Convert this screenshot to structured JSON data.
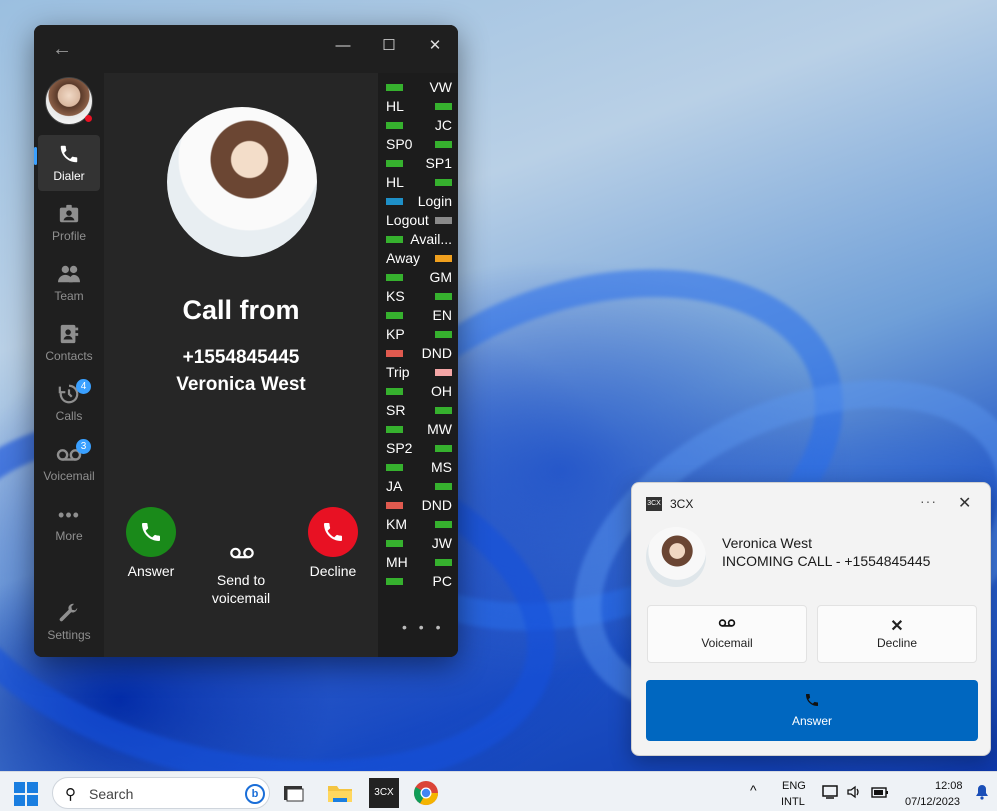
{
  "window": {
    "back_label": "←",
    "minimize_label": "—",
    "maximize_label": "☐",
    "close_label": "✕"
  },
  "nav": {
    "items": [
      {
        "label": "Dialer",
        "icon": "phone-icon",
        "active": true
      },
      {
        "label": "Profile",
        "icon": "id-badge-icon"
      },
      {
        "label": "Team",
        "icon": "team-icon"
      },
      {
        "label": "Contacts",
        "icon": "contacts-icon"
      },
      {
        "label": "Calls",
        "icon": "history-icon",
        "badge": "4"
      },
      {
        "label": "Voicemail",
        "icon": "voicemail-icon",
        "badge": "3"
      },
      {
        "label": "More",
        "icon": "more-icon"
      },
      {
        "label": "Settings",
        "icon": "wrench-icon"
      }
    ]
  },
  "call": {
    "heading": "Call from",
    "number": "+1554845445",
    "name": "Veronica West",
    "answer_label": "Answer",
    "voicemail_label_1": "Send to",
    "voicemail_label_2": "voicemail",
    "decline_label": "Decline",
    "answer_color": "#1a8a1a",
    "decline_color": "#e81123"
  },
  "presence": [
    {
      "label": "VW",
      "side": "right",
      "color": "#36b12e"
    },
    {
      "label": "HL",
      "side": "left",
      "color": "#36b12e"
    },
    {
      "label": "JC",
      "side": "right",
      "color": "#36b12e"
    },
    {
      "label": "SP0",
      "side": "left",
      "color": "#36b12e"
    },
    {
      "label": "SP1",
      "side": "right",
      "color": "#36b12e"
    },
    {
      "label": "HL",
      "side": "left",
      "color": "#36b12e"
    },
    {
      "label": "Login",
      "side": "right",
      "color": "#1e90c8"
    },
    {
      "label": "Logout",
      "side": "left",
      "color": "#8a8a8a"
    },
    {
      "label": "Avail...",
      "side": "right",
      "color": "#36b12e"
    },
    {
      "label": "Away",
      "side": "left",
      "color": "#f0a01e"
    },
    {
      "label": "GM",
      "side": "right",
      "color": "#36b12e"
    },
    {
      "label": "KS",
      "side": "left",
      "color": "#36b12e"
    },
    {
      "label": "EN",
      "side": "right",
      "color": "#36b12e"
    },
    {
      "label": "KP",
      "side": "left",
      "color": "#36b12e"
    },
    {
      "label": "DND",
      "side": "right",
      "color": "#e05a4f"
    },
    {
      "label": "Trip",
      "side": "left",
      "color": "#f4a6a6"
    },
    {
      "label": "OH",
      "side": "right",
      "color": "#36b12e"
    },
    {
      "label": "SR",
      "side": "left",
      "color": "#36b12e"
    },
    {
      "label": "MW",
      "side": "right",
      "color": "#36b12e"
    },
    {
      "label": "SP2",
      "side": "left",
      "color": "#36b12e"
    },
    {
      "label": "MS",
      "side": "right",
      "color": "#36b12e"
    },
    {
      "label": "JA",
      "side": "left",
      "color": "#36b12e"
    },
    {
      "label": "DND",
      "side": "right",
      "color": "#e05a4f"
    },
    {
      "label": "KM",
      "side": "left",
      "color": "#36b12e"
    },
    {
      "label": "JW",
      "side": "right",
      "color": "#36b12e"
    },
    {
      "label": "MH",
      "side": "left",
      "color": "#36b12e"
    },
    {
      "label": "PC",
      "side": "right",
      "color": "#36b12e"
    }
  ],
  "presence_more": "• • •",
  "toast": {
    "app_name": "3CX",
    "logo_text": "3CX",
    "more_label": "···",
    "close_label": "✕",
    "name": "Veronica West",
    "message": "INCOMING CALL - +1554845445",
    "voicemail_label": "Voicemail",
    "decline_label": "Decline",
    "answer_label": "Answer",
    "answer_color": "#0067c0"
  },
  "taskbar": {
    "search_placeholder": "Search",
    "bing_label": "b",
    "threecx_label": "3CX",
    "lang_1": "ENG",
    "lang_2": "INTL",
    "time": "12:08",
    "date": "07/12/2023",
    "chevron_label": "^"
  }
}
